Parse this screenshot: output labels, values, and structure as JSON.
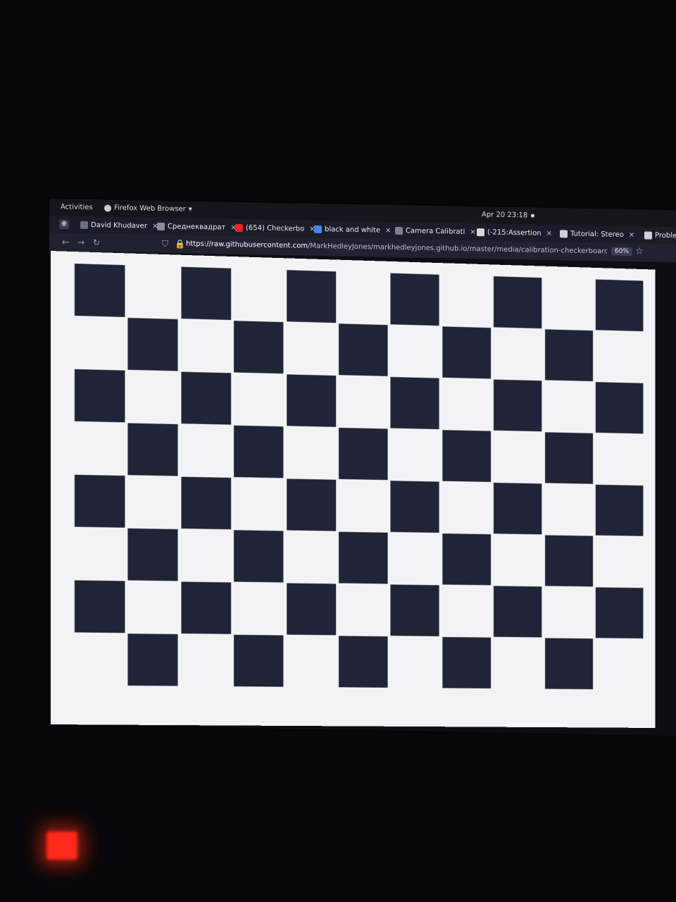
{
  "topbar": {
    "activities": "Activities",
    "app_name": "Firefox Web Browser",
    "clock": "Apr 20  23:18"
  },
  "tabs": [
    {
      "label": "David Khudaver",
      "favicon_color": "#6b6f7c"
    },
    {
      "label": "Среднеквадрат",
      "favicon_color": "#8c8f9a"
    },
    {
      "label": "(654) Checkerbo",
      "favicon_color": "#e42a22"
    },
    {
      "label": "black and white",
      "favicon_color": "#4a84f0"
    },
    {
      "label": "Camera Calibrati",
      "favicon_color": "#7d8090"
    },
    {
      "label": "(-215:Assertion",
      "favicon_color": "#d6d6de"
    },
    {
      "label": "Tutorial: Stereo",
      "favicon_color": "#cfd0d8"
    },
    {
      "label": "Proble",
      "favicon_color": "#cfd0d8"
    }
  ],
  "navbar": {
    "url_host": "https://raw.githubusercontent.com",
    "url_path": "/MarkHedleyJones/markhedleyjones.github.io/master/media/calibration-checkerboard-col",
    "zoom": "60%"
  },
  "checkerboard": {
    "rows": 8,
    "cols": 11,
    "dark_color": "#1f2536",
    "light_color": "#f3f3f6"
  }
}
